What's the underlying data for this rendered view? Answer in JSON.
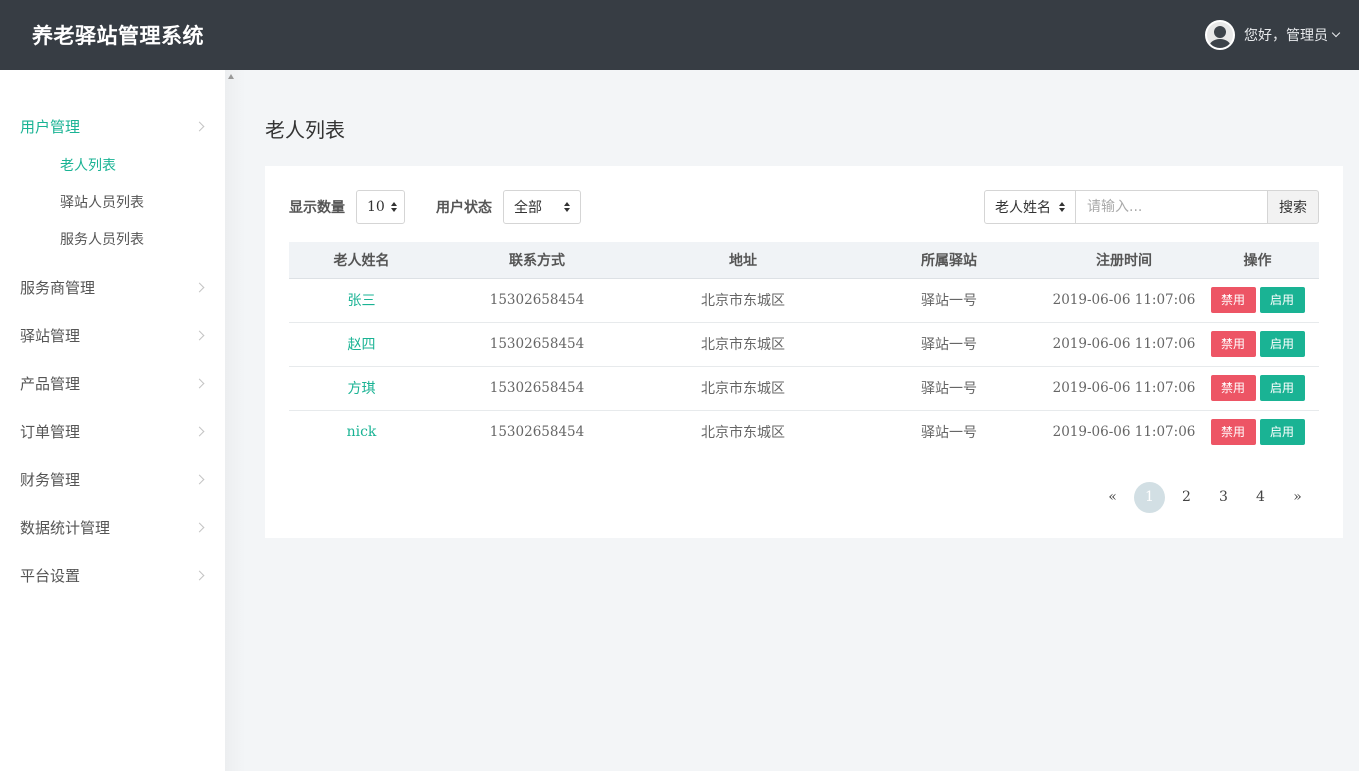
{
  "header": {
    "app_title": "养老驿站管理系统",
    "greeting": "您好，管理员"
  },
  "sidebar": {
    "user_mgmt": {
      "label": "用户管理",
      "children": [
        "老人列表",
        "驿站人员列表",
        "服务人员列表"
      ]
    },
    "items": [
      "服务商管理",
      "驿站管理",
      "产品管理",
      "订单管理",
      "财务管理",
      "数据统计管理",
      "平台设置"
    ]
  },
  "page_title": "老人列表",
  "filters": {
    "count_label": "显示数量",
    "count_value": "10",
    "status_label": "用户状态",
    "status_value": "全部"
  },
  "search": {
    "field": "老人姓名",
    "placeholder": "请输入...",
    "button": "搜索"
  },
  "table": {
    "headers": [
      "老人姓名",
      "联系方式",
      "地址",
      "所属驿站",
      "注册时间",
      "操作"
    ],
    "rows": [
      {
        "name": "张三",
        "phone": "15302658454",
        "address": "北京市东城区",
        "station": "驿站一号",
        "time": "2019-06-06 11:07:06"
      },
      {
        "name": "赵四",
        "phone": "15302658454",
        "address": "北京市东城区",
        "station": "驿站一号",
        "time": "2019-06-06 11:07:06"
      },
      {
        "name": "方琪",
        "phone": "15302658454",
        "address": "北京市东城区",
        "station": "驿站一号",
        "time": "2019-06-06 11:07:06"
      },
      {
        "name": "nick",
        "phone": "15302658454",
        "address": "北京市东城区",
        "station": "驿站一号",
        "time": "2019-06-06 11:07:06"
      }
    ],
    "disable_label": "禁用",
    "enable_label": "启用"
  },
  "pagination": {
    "prev": "«",
    "pages": [
      "1",
      "2",
      "3",
      "4"
    ],
    "next": "»"
  },
  "colors": {
    "accent": "#1ab394",
    "danger": "#ed5565",
    "header_bg": "#373d44"
  }
}
